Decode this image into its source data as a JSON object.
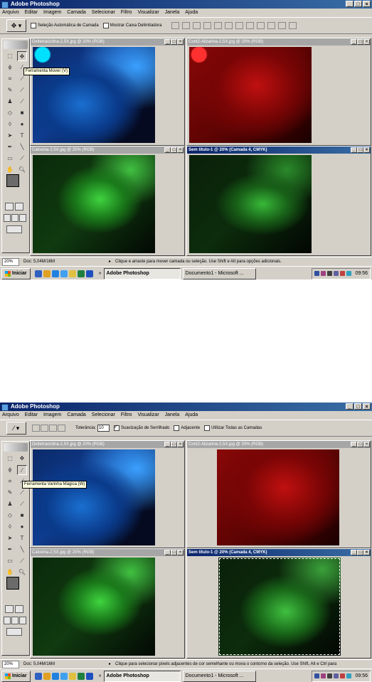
{
  "app": {
    "title": "Adobe Photoshop"
  },
  "menu": [
    "Arquivo",
    "Editar",
    "Imagem",
    "Camada",
    "Selecionar",
    "Filtro",
    "Visualizar",
    "Janela",
    "Ajuda"
  ],
  "window_controls": {
    "minimize": "_",
    "maximize": "□",
    "close": "×"
  },
  "screens": [
    {
      "options": {
        "tool_icon": "move-tool-icon",
        "auto_select_label": "Seleção Automática de Camada",
        "auto_select_checked": false,
        "show_bounds_label": "Mostrar Caixa Delimitadora",
        "show_bounds_checked": false
      },
      "tooltip": "Ferramenta Mover (V)",
      "documents": [
        {
          "title": "Oxitetraciclina-2,5X.jpg @ 20% (RGB)",
          "color": "blue",
          "active": false
        },
        {
          "title": "Cont2-Alizarina-2,5X.jpg @ 20% (RGB)",
          "color": "red",
          "active": false
        },
        {
          "title": "Calceina-2,5X.jpg @ 20% (RGB)",
          "color": "green",
          "active": false
        },
        {
          "title": "Sem título-1 @ 20% (Camada 4, CMYK)",
          "color": "green-dark",
          "active": true
        }
      ],
      "status": {
        "zoom": "20%",
        "doc": "Doc: 5,04M/16M",
        "hint": "Clique e arraste para mover camada ou seleção. Use Shift e Alt para opções adicionais."
      }
    },
    {
      "options": {
        "tool_icon": "magic-wand-tool-icon",
        "tolerance_label": "Tolerância:",
        "tolerance_value": "10",
        "antialias_label": "Suavização de Serrilhado",
        "antialias_checked": true,
        "contiguous_label": "Adjacente",
        "contiguous_checked": false,
        "all_layers_label": "Utilizar Todas as Camadas",
        "all_layers_checked": false
      },
      "tooltip": "Ferramenta Varinha Mágica (W)",
      "documents": [
        {
          "title": "Oxitetraciclina-2,5X.jpg @ 20% (RGB)",
          "color": "blue",
          "active": false
        },
        {
          "title": "Cont2-Alizarina-2,5X.jpg @ 20% (RGB)",
          "color": "red",
          "active": false
        },
        {
          "title": "Calceina-2,5X.jpg @ 20% (RGB)",
          "color": "green",
          "active": false
        },
        {
          "title": "Sem título-1 @ 20% (Camada 4, CMYK)",
          "color": "green-dark",
          "active": true
        }
      ],
      "status": {
        "zoom": "20%",
        "doc": "Doc: 5,04M/16M",
        "hint": "Clique para selecionar pixels adjacentes de cor semelhante ou mova o contorno da seleção. Use Shift, Alt e Ctrl para"
      }
    }
  ],
  "taskbar": {
    "start": "Iniciar",
    "items": [
      "Adobe Photoshop",
      "Documento1 - Microsoft ..."
    ],
    "clock": "09:56",
    "arrows": "»"
  }
}
